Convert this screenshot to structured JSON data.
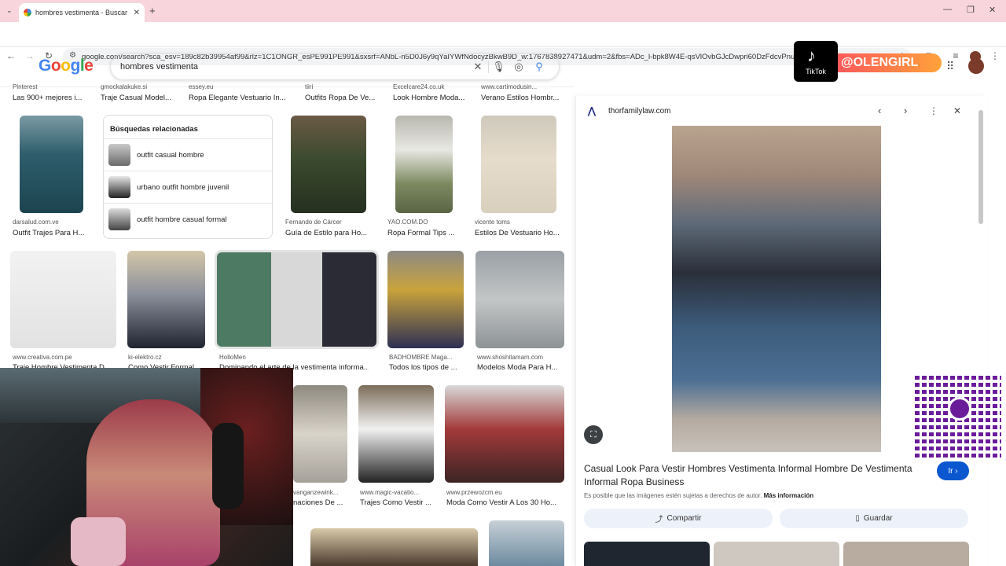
{
  "browser": {
    "tab_title": "hombres vestimenta - Buscar co",
    "url": "google.com/search?sca_esv=189c82b39954af99&rlz=1C1ONGR_esPE991PE991&sxsrf=ANbL-n5D0J6y9qYaIYWfNdocyzBkwB9D_w:1767838927471&udm=2&fbs=ADc_l-bpk8W4E-qsVlOvbGJcDwpri60DzFdcvPnuv8WQohHLTaf9fS4tJ71bi2aHS-8veg..."
  },
  "google": {
    "logo": "Google",
    "query": "hombres vestimenta"
  },
  "row0": [
    {
      "src": "Pinterest",
      "cap": "Las 900+ mejores i..."
    },
    {
      "src": "gmockalakuke.si",
      "cap": "Traje Casual Model..."
    },
    {
      "src": "essey.eu",
      "cap": "Ropa Elegante Vestuario In..."
    },
    {
      "src": "tiiri",
      "cap": "Outfits Ropa De Ve..."
    },
    {
      "src": "Excelcare24.co.uk",
      "cap": "Look Hombre Moda..."
    },
    {
      "src": "www.cartimodusin...",
      "cap": "Verano Estilos Hombr..."
    }
  ],
  "related": {
    "heading": "Búsquedas relacionadas",
    "items": [
      "outfit casual hombre",
      "urbano outfit hombre juvenil",
      "outfit hombre casual formal"
    ]
  },
  "row1": [
    {
      "src": "darsalud.com.ve",
      "cap": "Outfit Trajes Para H..."
    },
    {
      "src": "Fernando de Cárcer",
      "cap": "Guía de Estilo para Ho..."
    },
    {
      "src": "YAO.COM.DO",
      "cap": "Ropa Formal Tips ..."
    },
    {
      "src": "vicente toms",
      "cap": "Estilos De Vestuario Ho..."
    }
  ],
  "row2": [
    {
      "src": "www.creativa.com.pe",
      "cap": "Traje Hombre Vestimenta D..."
    },
    {
      "src": "ki-elektro.cz",
      "cap": "Como Vestir Formal ..."
    },
    {
      "src": "HolloMen",
      "cap": "Dominando el arte de la vestimenta informa..."
    },
    {
      "src": "BADHOMBRE Maga...",
      "cap": "Todos los tipos de ..."
    },
    {
      "src": "www.shoshitamam.com",
      "cap": "Modelos Moda Para H..."
    }
  ],
  "row3": [
    {
      "src": "vanganzewink...",
      "cap": "naciones De ..."
    },
    {
      "src": "www.magic-vacatio...",
      "cap": "Trajes Como Vestir ..."
    },
    {
      "src": "www.przewozcm.eu",
      "cap": "Moda Como Vestir A Los 30 Ho..."
    }
  ],
  "panel": {
    "site": "thorfamilylaw.com",
    "title": "Casual Look Para Vestir Hombres Vestimenta Informal Hombre De Vestimenta Informal Ropa Business",
    "go": "Ir",
    "notice": "Es posible que las imágenes estén sujetas a derechos de autor.",
    "more": "Más información",
    "share": "Compartir",
    "save": "Guardar"
  },
  "overlay": {
    "tiktok_label": "TikTok",
    "tiktok_handle": "@OLENGIRL"
  }
}
